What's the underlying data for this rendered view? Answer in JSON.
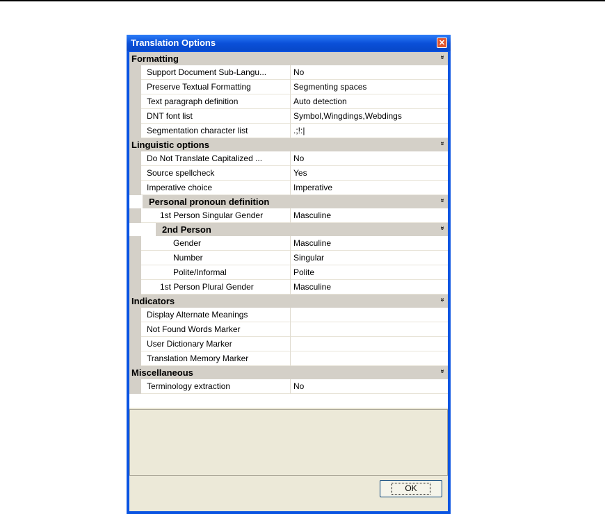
{
  "window": {
    "title": "Translation Options",
    "ok_label": "OK"
  },
  "categories": [
    {
      "label": "Formatting",
      "level": 0,
      "top": 0,
      "rows": [
        {
          "name": "Support Document Sub-Langu...",
          "value": "No"
        },
        {
          "name": "Preserve Textual Formatting",
          "value": "Segmenting spaces"
        },
        {
          "name": "Text paragraph definition",
          "value": "Auto detection"
        },
        {
          "name": "DNT font list",
          "value": "Symbol,Wingdings,Webdings"
        },
        {
          "name": "Segmentation character list",
          "value": ".;!:|"
        }
      ]
    },
    {
      "label": "Linguistic options",
      "level": 0,
      "rows": [
        {
          "name": "Do Not Translate Capitalized ...",
          "value": "No"
        },
        {
          "name": "Source spellcheck",
          "value": "Yes"
        },
        {
          "name": "Imperative choice",
          "value": "Imperative"
        }
      ]
    },
    {
      "label": "Personal pronoun definition",
      "level": 1,
      "rows": [
        {
          "name": "1st Person Singular Gender",
          "value": "Masculine"
        }
      ]
    },
    {
      "label": "2nd Person",
      "level": 2,
      "rows": [
        {
          "name": "Gender",
          "value": "Masculine"
        },
        {
          "name": "Number",
          "value": "Singular"
        },
        {
          "name": "Polite/Informal",
          "value": "Polite"
        }
      ],
      "after_rows": [
        {
          "name": "1st Person Plural Gender",
          "value": "Masculine",
          "level": 1
        }
      ]
    },
    {
      "label": "Indicators",
      "level": 0,
      "rows": [
        {
          "name": "Display Alternate Meanings",
          "value": ""
        },
        {
          "name": "Not Found Words Marker",
          "value": ""
        },
        {
          "name": "User Dictionary Marker",
          "value": ""
        },
        {
          "name": "Translation Memory Marker",
          "value": ""
        }
      ]
    },
    {
      "label": "Miscellaneous",
      "level": 0,
      "rows": [
        {
          "name": "Terminology extraction",
          "value": "No"
        }
      ]
    }
  ]
}
